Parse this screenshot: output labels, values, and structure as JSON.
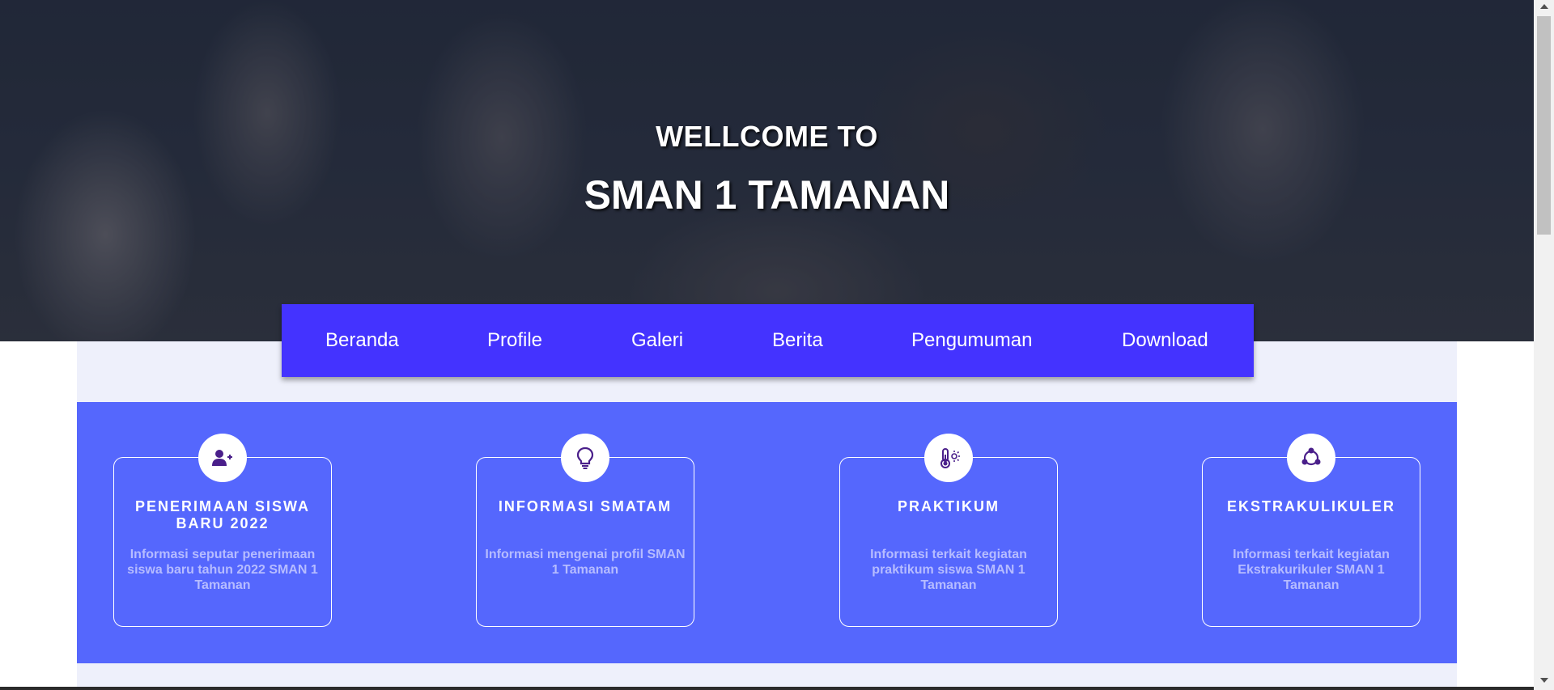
{
  "hero": {
    "pretitle": "WELLCOME TO",
    "title": "SMAN 1 TAMANAN"
  },
  "nav": {
    "items": [
      {
        "label": "Beranda"
      },
      {
        "label": "Profile"
      },
      {
        "label": "Galeri"
      },
      {
        "label": "Berita"
      },
      {
        "label": "Pengumuman"
      },
      {
        "label": "Download"
      }
    ]
  },
  "features": {
    "cards": [
      {
        "icon": "user-plus-icon",
        "title": "PENERIMAAN SISWA BARU 2022",
        "description": "Informasi seputar penerimaan siswa baru tahun 2022 SMAN 1 Tamanan"
      },
      {
        "icon": "lightbulb-icon",
        "title": "INFORMASI SMATAM",
        "description": "Informasi mengenai profil SMAN 1 Tamanan"
      },
      {
        "icon": "thermometer-sun-icon",
        "title": "PRAKTIKUM",
        "description": "Informasi terkait kegiatan praktikum siswa SMAN 1 Tamanan"
      },
      {
        "icon": "circle-nodes-icon",
        "title": "EKSTRAKULIKULER",
        "description": "Informasi terkait kegiatan Ekstrakurikuler SMAN 1 Tamanan"
      }
    ]
  },
  "colors": {
    "nav_bg": "#4433ff",
    "band_bg": "#5567fd",
    "wrapper_bg": "#eef0fb",
    "icon_color": "#4a1f8a",
    "card_desc": "#b6bcff"
  }
}
